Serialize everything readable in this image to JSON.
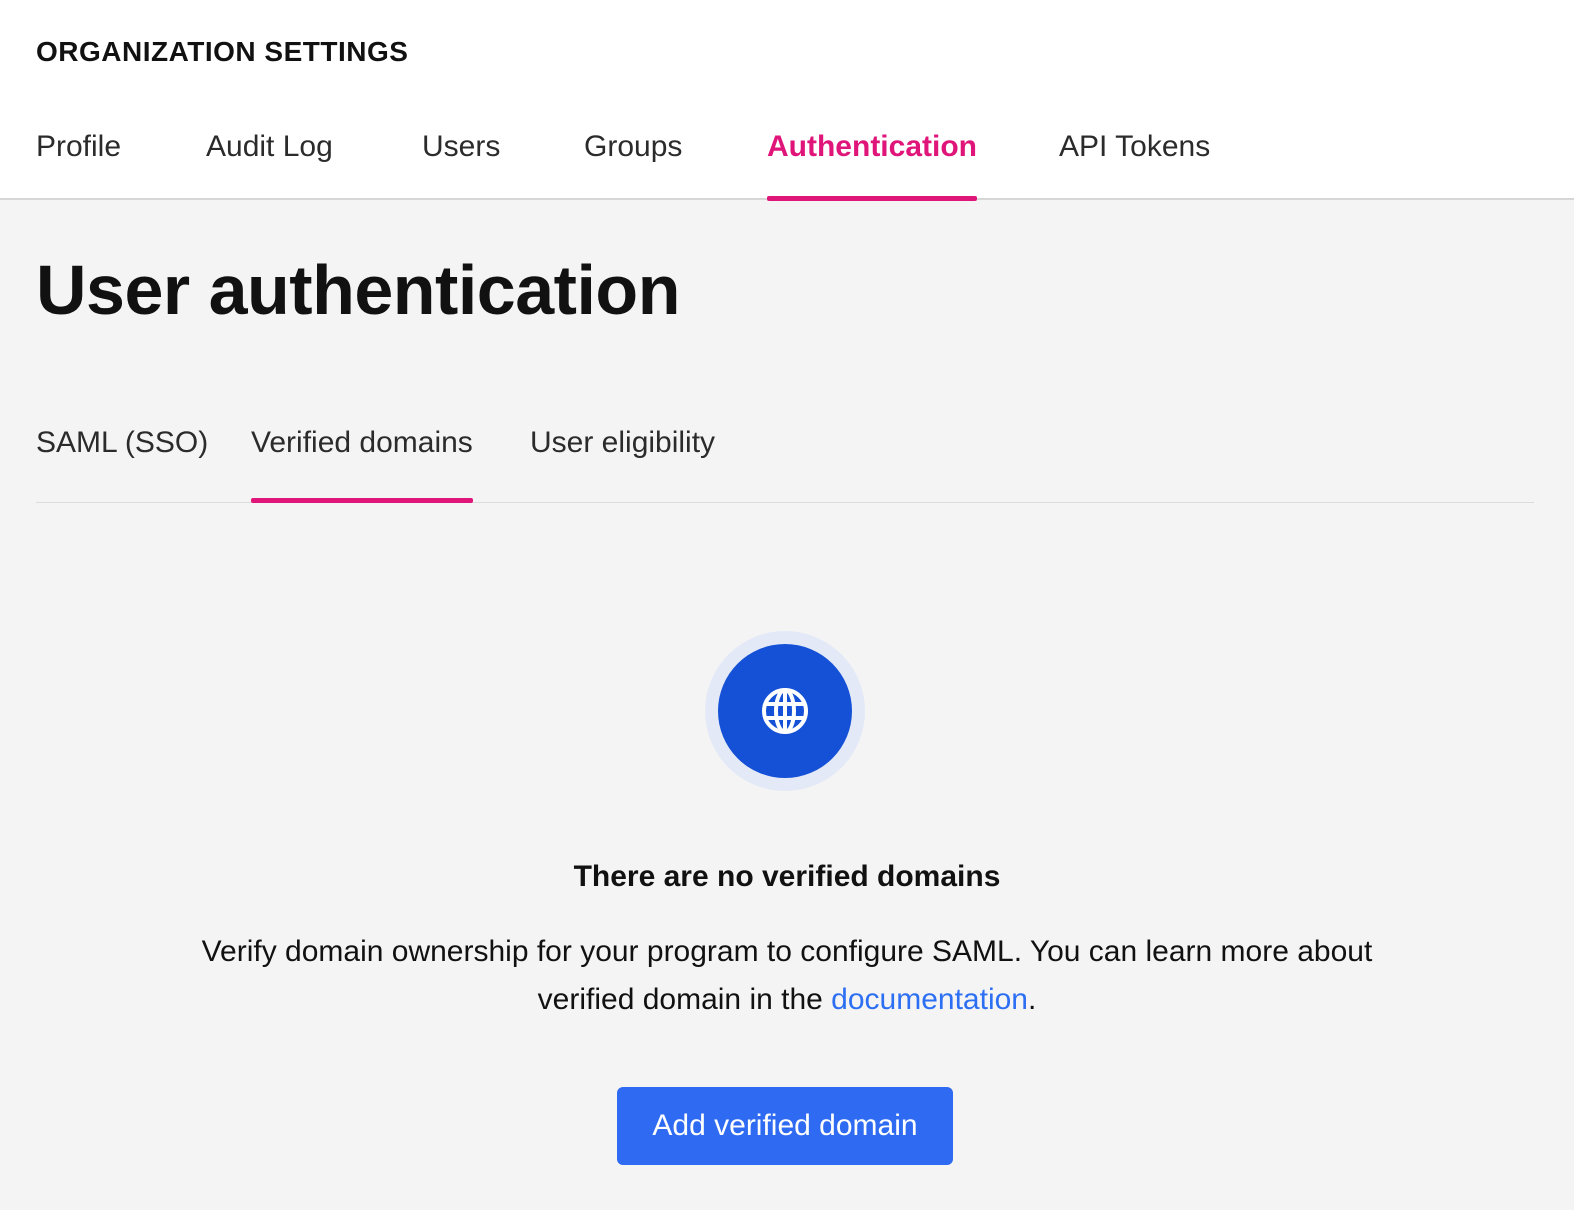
{
  "header": {
    "org_title": "ORGANIZATION SETTINGS",
    "tabs": [
      {
        "label": "Profile",
        "active": false
      },
      {
        "label": "Audit Log",
        "active": false
      },
      {
        "label": "Users",
        "active": false
      },
      {
        "label": "Groups",
        "active": false
      },
      {
        "label": "Authentication",
        "active": true
      },
      {
        "label": "API Tokens",
        "active": false
      }
    ]
  },
  "main": {
    "page_title": "User authentication",
    "sub_tabs": [
      {
        "label": "SAML (SSO)",
        "active": false
      },
      {
        "label": "Verified domains",
        "active": true
      },
      {
        "label": "User eligibility",
        "active": false
      }
    ],
    "empty_state": {
      "icon": "globe-icon",
      "heading": "There are no verified domains",
      "description_prefix": "Verify domain ownership for your program to configure SAML. You can learn more about verified domain in the ",
      "link_text": "documentation",
      "description_suffix": ".",
      "button_label": "Add verified domain"
    }
  },
  "colors": {
    "accent_pink": "#e0157a",
    "primary_blue": "#2f6bf2",
    "icon_blue": "#1551d6",
    "link_blue": "#2d6ff3"
  }
}
